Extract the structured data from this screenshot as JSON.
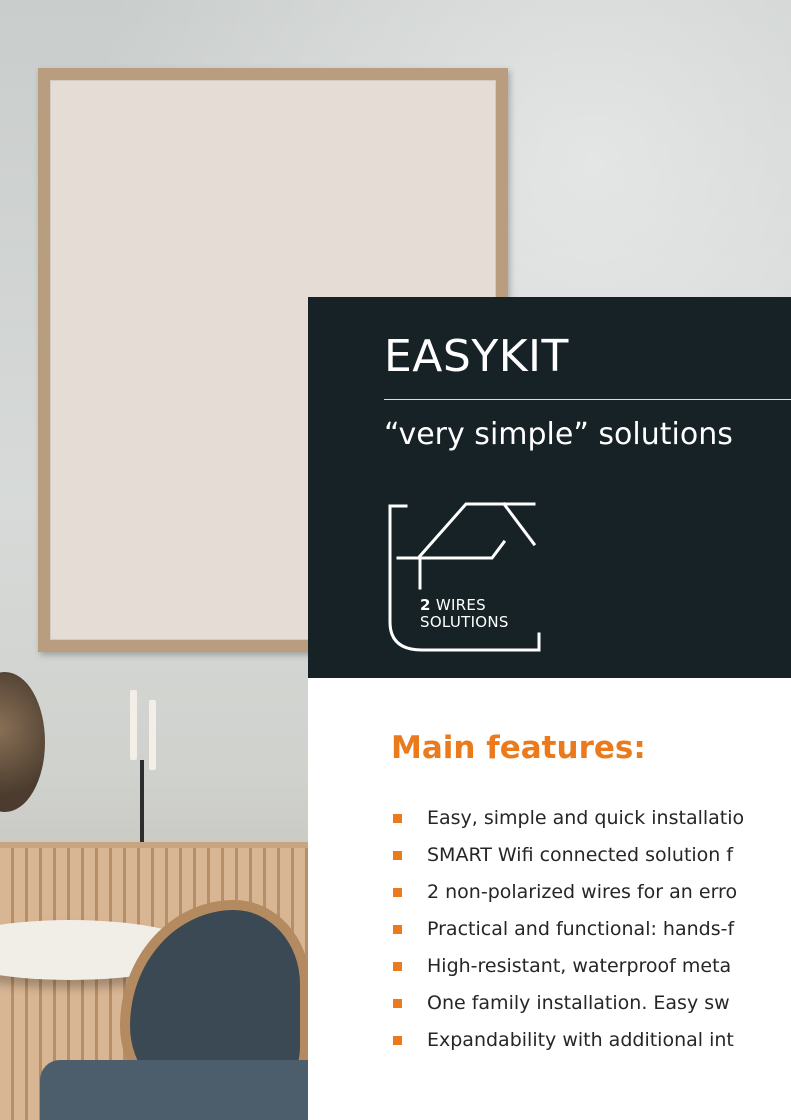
{
  "panel": {
    "title": "EASYKIT",
    "subtitle": "“very simple” solutions",
    "badge": {
      "number": "2",
      "line1": "WIRES",
      "line2": "SOLUTIONS",
      "icon": "house-outline-icon"
    }
  },
  "features": {
    "heading": "Main features:",
    "items": [
      "Easy, simple and quick installatio",
      "SMART Wifi connected solution f",
      "2 non-polarized wires for an erro",
      "Practical and functional: hands-f",
      "High-resistant, waterproof  meta",
      "One family installation.  Easy sw",
      "Expandability with additional  int"
    ]
  },
  "colors": {
    "panel_bg": "#172226",
    "accent": "#ea7a1c",
    "text": "#262626"
  }
}
